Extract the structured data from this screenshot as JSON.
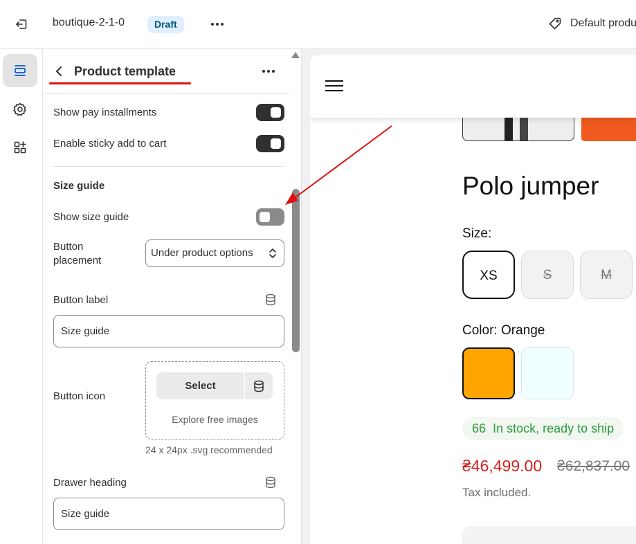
{
  "topbar": {
    "store_name": "boutique-2-1-0",
    "status_badge": "Draft",
    "template_selector": "Default product"
  },
  "rail": {
    "items": [
      {
        "icon": "sections-icon",
        "active": true
      },
      {
        "icon": "gear-icon",
        "active": false
      },
      {
        "icon": "apps-icon",
        "active": false
      }
    ]
  },
  "panel": {
    "title": "Product template",
    "toggles": [
      {
        "label": "Show pay installments",
        "on": true
      },
      {
        "label": "Enable sticky add to cart",
        "on": true
      }
    ],
    "size_guide": {
      "heading": "Size guide",
      "show_label": "Show size guide",
      "show_on": false,
      "placement_label": "Button placement",
      "placement_value": "Under product options",
      "button_label_label": "Button label",
      "button_label_value": "Size guide",
      "button_icon_label": "Button icon",
      "select_label": "Select",
      "explore_label": "Explore free images",
      "icon_hint": "24 x 24px .svg recommended",
      "drawer_heading_label": "Drawer heading",
      "drawer_heading_value": "Size guide"
    }
  },
  "preview": {
    "product_title": "Polo jumper",
    "size_label": "Size:",
    "sizes": [
      {
        "label": "XS",
        "selected": true,
        "available": true
      },
      {
        "label": "S",
        "selected": false,
        "available": false
      },
      {
        "label": "M",
        "selected": false,
        "available": false
      }
    ],
    "color_label": "Color:",
    "color_value": "Orange",
    "swatches": [
      {
        "name": "Orange",
        "color": "#ffa500",
        "selected": true
      },
      {
        "name": "Azure",
        "color": "#f0ffff",
        "selected": false
      }
    ],
    "stock_count": "66",
    "stock_text": "In stock, ready to ship",
    "price": "₴46,499.00",
    "compare_price": "₴62,837.00",
    "tax_note": "Tax included."
  },
  "colors": {
    "accent_red": "#e01010",
    "toggle_on": "#303030",
    "toggle_off": "#8a8a8a",
    "badge_bg": "#e0efff",
    "sale_price": "#d41d1d",
    "stock_green": "#2e9a3a"
  }
}
